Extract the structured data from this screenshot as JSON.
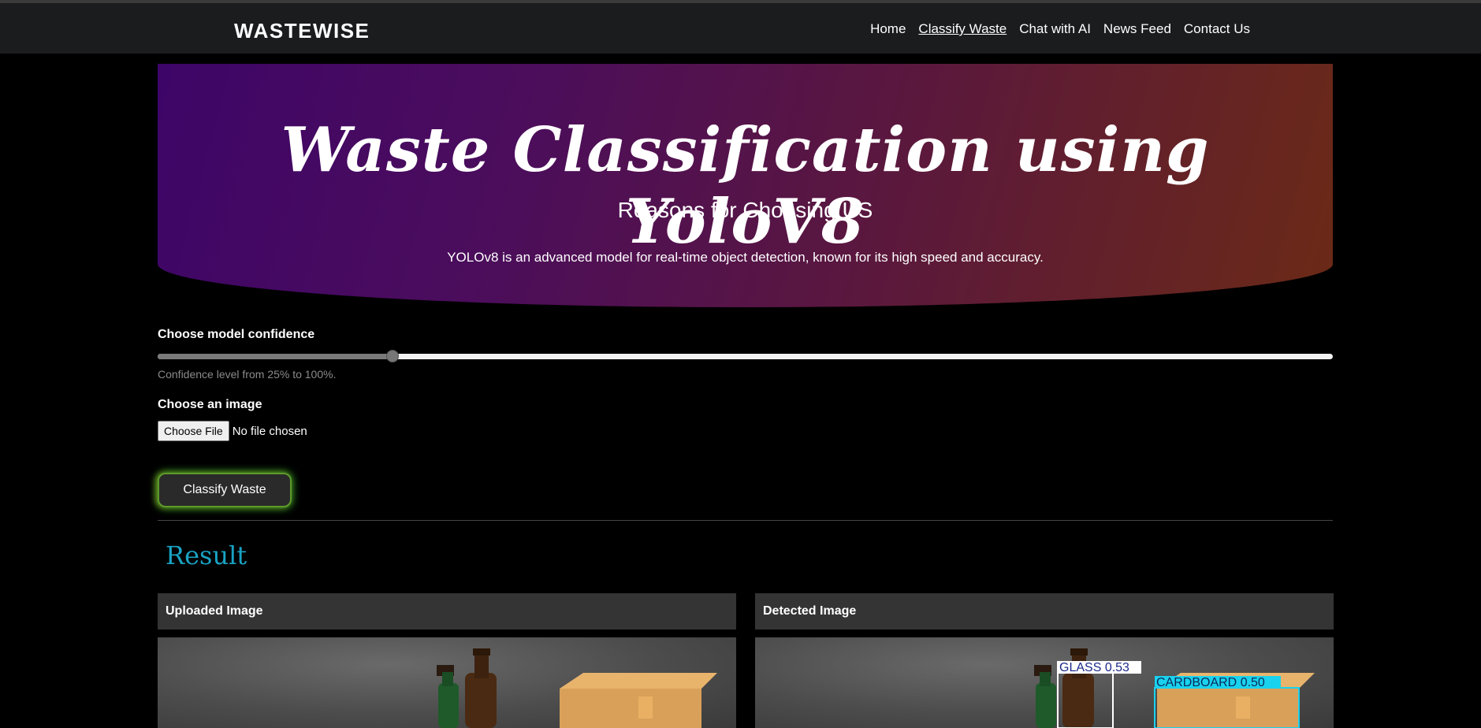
{
  "nav": {
    "brand": "WASTEWISE",
    "links": [
      "Home",
      "Classify Waste",
      "Chat with AI",
      "News Feed",
      "Contact Us"
    ],
    "active_index": 1
  },
  "hero": {
    "title": "Waste Classification using YoloV8",
    "subtitle": "Reasons for Choosing US",
    "description": "YOLOv8 is an advanced model for real-time object detection, known for its high speed and accuracy."
  },
  "confidence": {
    "label": "Choose model confidence",
    "hint": "Confidence level from 25% to 100%.",
    "min": 25,
    "max": 100,
    "value": 40
  },
  "upload": {
    "label": "Choose an image",
    "button": "Choose File",
    "status": "No file chosen"
  },
  "classify_button": "Classify Waste",
  "result": {
    "title": "Result",
    "uploaded_header": "Uploaded Image",
    "detected_header": "Detected Image",
    "detections": [
      {
        "label": "GLASS",
        "score": "0.53",
        "color": "#ffffff"
      },
      {
        "label": "CARDBOARD",
        "score": "0.50",
        "color": "#19d2ee"
      }
    ]
  },
  "colors": {
    "navbar_bg": "#1a1c1e",
    "hero_gradient_start": "#3e0568",
    "hero_gradient_end": "#6b2a16",
    "result_title": "#19a3c4",
    "button_glow": "#3ce63c"
  }
}
